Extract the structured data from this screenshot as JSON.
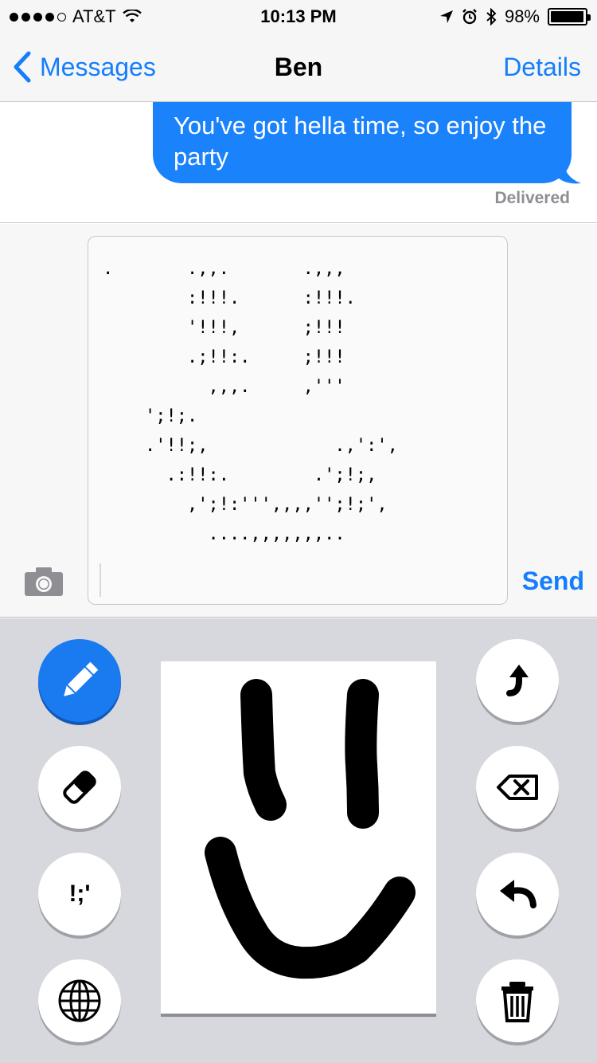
{
  "status_bar": {
    "carrier": "AT&T",
    "time": "10:13 PM",
    "battery_percent": "98%",
    "battery_level": 0.98,
    "signal_bars_filled": 4,
    "signal_bars_total": 5
  },
  "nav": {
    "back_label": "Messages",
    "title": "Ben",
    "details_label": "Details"
  },
  "thread": {
    "message_text": "You've got hella time, so enjoy the party",
    "delivered_label": "Delivered"
  },
  "composer": {
    "ascii_art": ".       .,,.       .,,,\n        :!!!.      :!!!.\n        '!!!,      ;!!!\n        .;!!:.     ;!!!\n          ,,,.     ,'''\n    ';!;.\n    .'!!;,            .,':',\n      .:!!:.        .';!;,\n        ,';!:''',,,,'';!;',\n          ....,,,,,,,..",
    "send_label": "Send"
  },
  "keyboard": {
    "punct_key_label": "!;'"
  },
  "colors": {
    "accent": "#147efb",
    "bubble": "#1a82fb"
  }
}
